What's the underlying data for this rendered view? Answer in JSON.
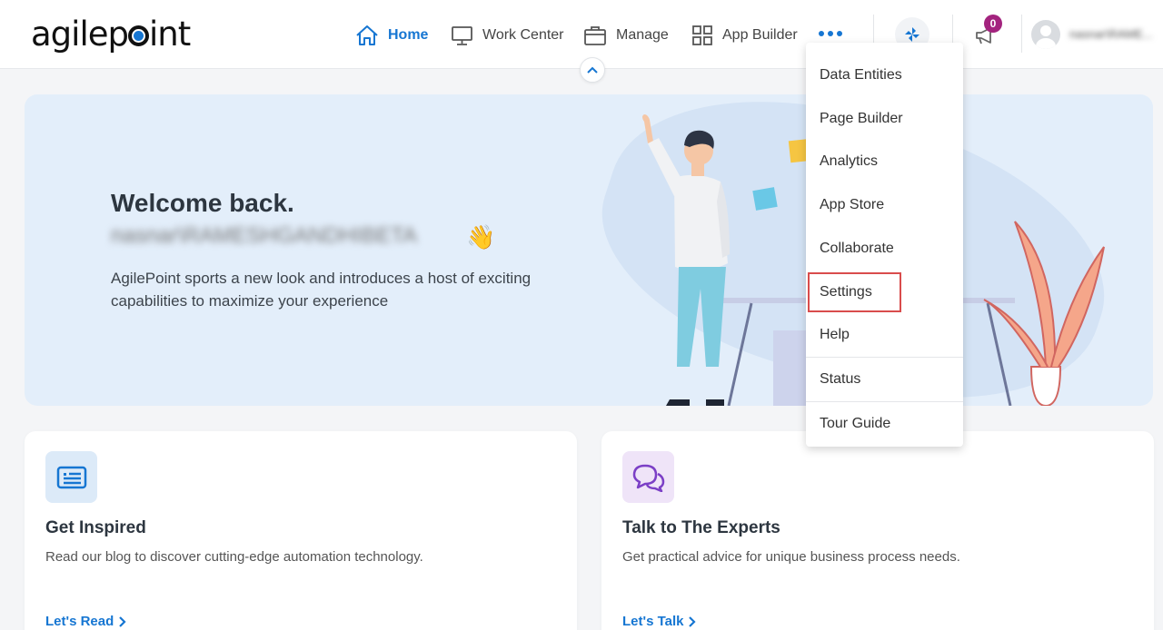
{
  "header": {
    "logo_text_left": "agilep",
    "logo_text_right": "int",
    "nav": {
      "home": "Home",
      "work_center": "Work Center",
      "manage": "Manage",
      "app_builder": "App Builder"
    },
    "notification_count": "0",
    "username": "nasnar\\RAME..."
  },
  "hero": {
    "welcome": "Welcome back.",
    "user": "nasnar\\RAMESHGANDHIBETA",
    "wave": "👋",
    "description": "AgilePoint sports a new look and introduces a host of exciting capabilities to maximize your experience"
  },
  "cards": [
    {
      "title": "Get Inspired",
      "text": "Read our blog to discover cutting-edge automation technology.",
      "link": "Let's Read"
    },
    {
      "title": "Talk to The Experts",
      "text": "Get practical advice for unique business process needs.",
      "link": "Let's Talk"
    }
  ],
  "menu": {
    "items": [
      "Data Entities",
      "Page Builder",
      "Analytics",
      "App Store",
      "Collaborate",
      "Settings",
      "Help",
      "Status",
      "Tour Guide"
    ]
  },
  "colors": {
    "accent": "#1676d2",
    "badge": "#a3237e",
    "highlight": "#d94c4c"
  }
}
